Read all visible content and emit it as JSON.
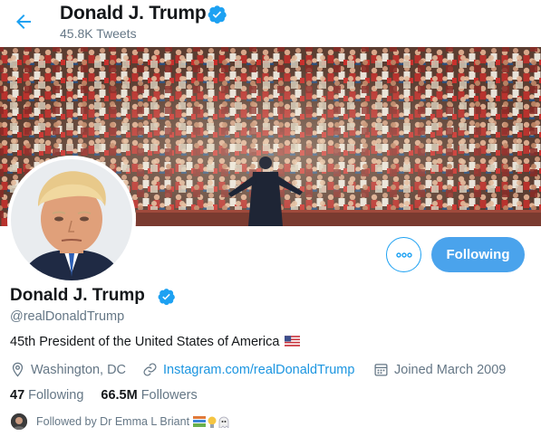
{
  "header": {
    "name": "Donald J. Trump",
    "tweets_count": "45.8K Tweets"
  },
  "profile": {
    "name": "Donald J. Trump",
    "handle": "@realDonaldTrump",
    "bio": "45th President of the United States of America",
    "location": "Washington, DC",
    "website": "Instagram.com/realDonaldTrump",
    "joined": "Joined March 2009",
    "following_count": "47",
    "following_label": "Following",
    "followers_count": "66.5M",
    "followers_label": "Followers",
    "followed_by": "Followed by Dr Emma L Briant"
  },
  "actions": {
    "follow_button": "Following"
  },
  "colors": {
    "accent": "#1da1f2",
    "button": "#4aa3ec",
    "muted": "#657786"
  }
}
